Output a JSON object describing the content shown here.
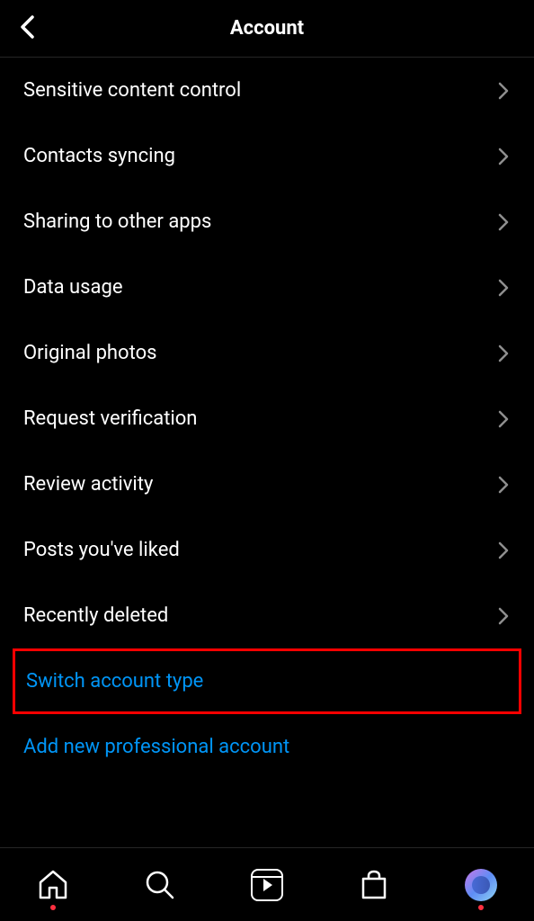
{
  "header": {
    "title": "Account"
  },
  "settings": {
    "items": [
      {
        "label": "Sensitive content control"
      },
      {
        "label": "Contacts syncing"
      },
      {
        "label": "Sharing to other apps"
      },
      {
        "label": "Data usage"
      },
      {
        "label": "Original photos"
      },
      {
        "label": "Request verification"
      },
      {
        "label": "Review activity"
      },
      {
        "label": "Posts you've liked"
      },
      {
        "label": "Recently deleted"
      }
    ]
  },
  "actions": {
    "switch_account": "Switch account type",
    "add_professional": "Add new professional account"
  }
}
